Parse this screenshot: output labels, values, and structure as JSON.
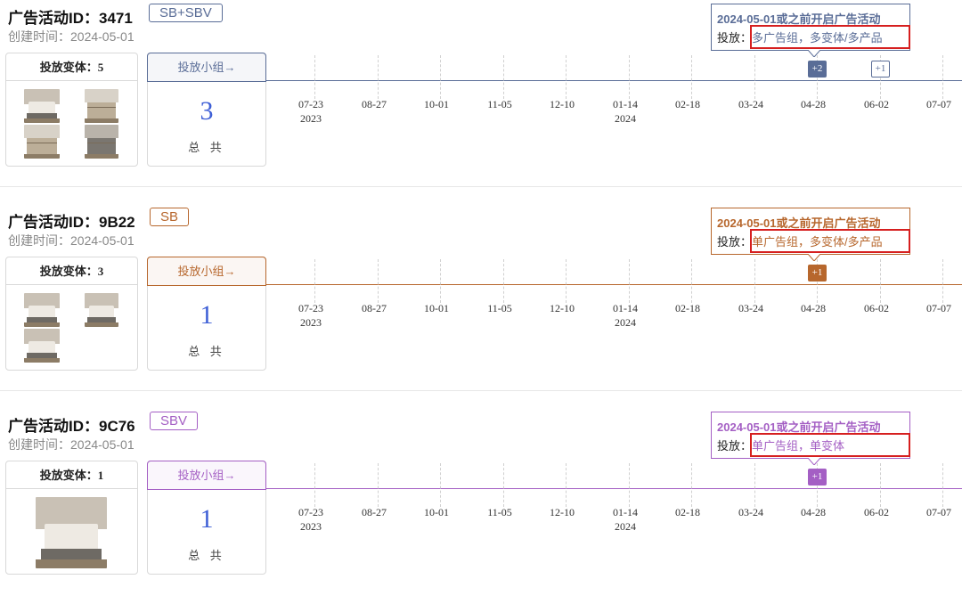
{
  "common": {
    "variants_label": "投放变体：",
    "group_button_label": "投放小组→",
    "total_label": "总 共",
    "dates": [
      {
        "label": "07-23",
        "year": "2023"
      },
      {
        "label": "08-27",
        "year": ""
      },
      {
        "label": "10-01",
        "year": ""
      },
      {
        "label": "11-05",
        "year": ""
      },
      {
        "label": "12-10",
        "year": ""
      },
      {
        "label": "01-14",
        "year": "2024"
      },
      {
        "label": "02-18",
        "year": ""
      },
      {
        "label": "03-24",
        "year": ""
      },
      {
        "label": "04-28",
        "year": ""
      },
      {
        "label": "06-02",
        "year": ""
      },
      {
        "label": "07-07",
        "year": ""
      }
    ],
    "annotation_title": "2024-05-01或之前开启广告活动",
    "annotation_prefix": "投放：",
    "highlight_color": "#d61f1f"
  },
  "campaigns": [
    {
      "title": "广告活动ID：3471",
      "badge": "SB+SBV",
      "created": "创建时间：2024-05-01",
      "variant_count": "5",
      "group_total": "3",
      "annotation_value": "多广告组，多变体/多产品",
      "accent": "#5a6d97",
      "markers": [
        {
          "label": "+2",
          "style": "filled",
          "date": "04-28"
        },
        {
          "label": "+1",
          "style": "outline",
          "date": "06-02"
        }
      ],
      "thumbnails": [
        "bedroom-photo",
        "dresser-photo",
        "dresser-photo",
        "dark-dresser-photo"
      ]
    },
    {
      "title": "广告活动ID：9B22",
      "badge": "SB",
      "created": "创建时间：2024-05-01",
      "variant_count": "3",
      "group_total": "1",
      "annotation_value": "单广告组，多变体/多产品",
      "accent": "#b7672d",
      "markers": [
        {
          "label": "+1",
          "style": "filled",
          "date": "04-28"
        }
      ],
      "thumbnails": [
        "bedroom-photo",
        "bedroom-photo",
        "bedroom-photo"
      ]
    },
    {
      "title": "广告活动ID：9C76",
      "badge": "SBV",
      "created": "创建时间：2024-05-01",
      "variant_count": "1",
      "group_total": "1",
      "annotation_value": "单广告组，单变体",
      "accent": "#a45fc4",
      "markers": [
        {
          "label": "+1",
          "style": "filled",
          "date": "04-28"
        }
      ],
      "thumbnails": [
        "bedroom-photo-large"
      ]
    }
  ]
}
